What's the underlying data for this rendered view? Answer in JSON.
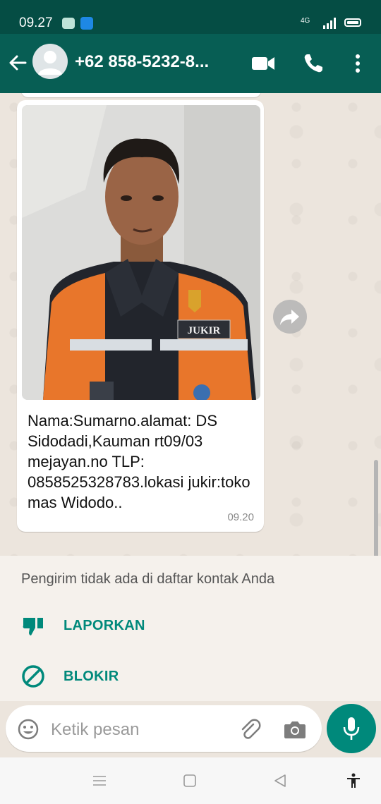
{
  "status_bar": {
    "time": "09.27",
    "network": "4G"
  },
  "header": {
    "contact_name": "+62 858-5232-8..."
  },
  "message": {
    "caption": "Nama:Sumarno.alamat: DS Sidodadi,Kauman rt09/03 mejayan.no TLP: 0858525328783.lokasi jukir:toko mas Widodo..",
    "time": "09.20",
    "photo_badge_text": "JUKIR"
  },
  "unknown_sender": {
    "notice": "Pengirim tidak ada di daftar kontak Anda",
    "report_label": "LAPORKAN",
    "block_label": "BLOKIR"
  },
  "composer": {
    "placeholder": "Ketik pesan"
  },
  "colors": {
    "header": "#075e54",
    "accent": "#00897b",
    "chat_background": "#ece5dd"
  }
}
